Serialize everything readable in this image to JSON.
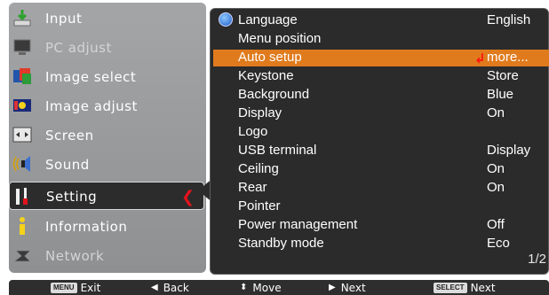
{
  "left_menu": {
    "items": [
      {
        "label": "Input",
        "icon": "input-icon"
      },
      {
        "label": "PC adjust",
        "icon": "pc-adjust-icon"
      },
      {
        "label": "Image select",
        "icon": "image-select-icon"
      },
      {
        "label": "Image adjust",
        "icon": "image-adjust-icon"
      },
      {
        "label": "Screen",
        "icon": "screen-icon"
      },
      {
        "label": "Sound",
        "icon": "sound-icon"
      },
      {
        "label": "Setting",
        "icon": "setting-icon"
      },
      {
        "label": "Information",
        "icon": "information-icon"
      },
      {
        "label": "Network",
        "icon": "network-icon"
      }
    ],
    "selected": "Setting"
  },
  "settings": {
    "rows": [
      {
        "name": "Language",
        "value": "English"
      },
      {
        "name": "Menu position",
        "value": ""
      },
      {
        "name": "Auto setup",
        "value": "more..."
      },
      {
        "name": "Keystone",
        "value": "Store"
      },
      {
        "name": "Background",
        "value": "Blue"
      },
      {
        "name": "Display",
        "value": "On"
      },
      {
        "name": "Logo",
        "value": ""
      },
      {
        "name": "USB terminal",
        "value": "Display"
      },
      {
        "name": "Ceiling",
        "value": "On"
      },
      {
        "name": "Rear",
        "value": "On"
      },
      {
        "name": "Pointer",
        "value": ""
      },
      {
        "name": "Power management",
        "value": "Off"
      },
      {
        "name": "Standby mode",
        "value": "Eco"
      }
    ],
    "highlighted": "Auto setup",
    "page": "1/2"
  },
  "status_bar": {
    "exit_key": "MENU",
    "exit_label": "Exit",
    "back_label": "Back",
    "move_label": "Move",
    "next_label": "Next",
    "select_key": "SELECT",
    "select_label": "Next"
  },
  "colors": {
    "highlight": "#e07b1d",
    "panel": "#2b2b2b",
    "menu_bg": "#9a9b9d",
    "arrow_red": "#e0141d"
  }
}
